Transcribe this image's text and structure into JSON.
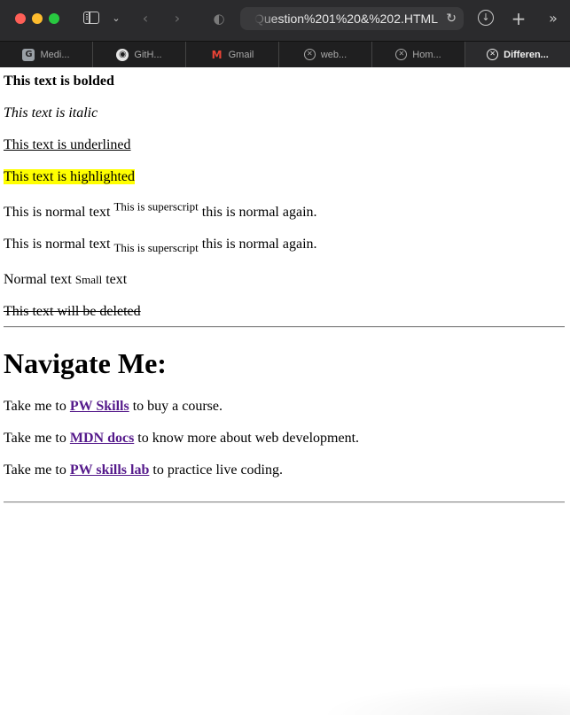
{
  "browser": {
    "address": "Question%201%20&%202.HTML",
    "tabs": [
      {
        "label": "Medi...",
        "favicon": "g-icon"
      },
      {
        "label": "GitH...",
        "favicon": "github-icon"
      },
      {
        "label": "Gmail",
        "favicon": "gmail-icon"
      },
      {
        "label": "web...",
        "favicon": "compass-icon"
      },
      {
        "label": "Hom...",
        "favicon": "compass-icon"
      },
      {
        "label": "Differen...",
        "favicon": "compass-icon",
        "active": true
      }
    ]
  },
  "page": {
    "bold_text": "This text is bolded",
    "italic_text": "This text is italic",
    "underlined_text": "This text is underlined",
    "highlighted_text": "This text is highlighted",
    "superscript_line": {
      "before": "This is normal text",
      "sup": "This is superscript",
      "after": "this is normal again."
    },
    "subscript_line": {
      "before": "This is normal text",
      "sub": "This is superscript",
      "after": "this is normal again."
    },
    "small_line": {
      "before": "Normal text",
      "small": "Small",
      "after": "text"
    },
    "deleted_text": "This text will be deleted",
    "heading": "Navigate Me:",
    "links": [
      {
        "prefix": "Take me to",
        "link": "PW Skills",
        "suffix": "to buy a course."
      },
      {
        "prefix": "Take me to",
        "link": "MDN docs",
        "suffix": "to know more about web development."
      },
      {
        "prefix": "Take me to",
        "link": "PW skills lab",
        "suffix": "to practice live coding."
      }
    ]
  },
  "colors": {
    "highlight": "#ffff00",
    "visited_link": "#551a8b",
    "chrome_bg": "#2b2b2d"
  }
}
